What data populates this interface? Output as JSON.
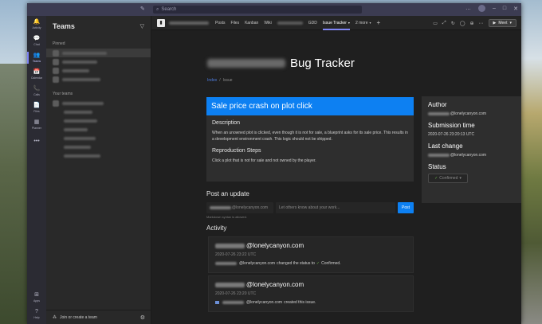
{
  "titlebar": {
    "search_placeholder": "Search",
    "nav_icon": "compose-icon",
    "controls": [
      "…",
      "–",
      "□",
      "✕"
    ]
  },
  "rail": {
    "items": [
      {
        "label": "Activity",
        "icon": "bell-icon",
        "glyph": "🔔"
      },
      {
        "label": "Chat",
        "icon": "chat-icon",
        "glyph": "💬"
      },
      {
        "label": "Teams",
        "icon": "teams-icon",
        "glyph": "👥",
        "active": true
      },
      {
        "label": "Calendar",
        "icon": "calendar-icon",
        "glyph": "📅"
      },
      {
        "label": "Calls",
        "icon": "phone-icon",
        "glyph": "📞"
      },
      {
        "label": "Files",
        "icon": "file-icon",
        "glyph": "📄"
      },
      {
        "label": "Planner",
        "icon": "planner-icon",
        "glyph": "▦"
      },
      {
        "label": "",
        "icon": "more-icon",
        "glyph": "•••"
      }
    ],
    "bottom": [
      {
        "label": "Apps",
        "icon": "apps-icon",
        "glyph": "⊞"
      },
      {
        "label": "Help",
        "icon": "help-icon",
        "glyph": "?"
      }
    ]
  },
  "panel": {
    "title": "Teams",
    "pinned_label": "Pinned",
    "your_teams_label": "Your teams",
    "join_label": "Join or create a team"
  },
  "channel": {
    "tabs": [
      "Posts",
      "Files",
      "Kanban",
      "Wiki",
      "GDD",
      "Issue Tracker",
      "2 more"
    ],
    "meet_label": "Meet"
  },
  "page": {
    "title_suffix": "Bug Tracker",
    "crumb_index": "Index",
    "crumb_sep": "/",
    "crumb_current": "Issue"
  },
  "issue": {
    "title": "Sale price crash on plot click",
    "desc_heading": "Description",
    "desc_text": "When an unowned plot is clicked, even though it is not for sale, a blueprint asks for its sale price. This results in a development environment crash. This logic should not be shipped.",
    "repro_heading": "Reproduction Steps",
    "repro_text": "Click a plot that is not for sale and not owned by the player."
  },
  "meta": {
    "author_label": "Author",
    "author_email": "@lonelycanyon.com",
    "submitted_label": "Submission time",
    "submitted_value": "2020-07-26 23:20:13 UTC",
    "last_change_label": "Last change",
    "last_change_email": "@lonelycanyon.com",
    "status_label": "Status",
    "status_value": "Confirmed"
  },
  "post": {
    "heading": "Post an update",
    "email": "@lonelycanyon.com",
    "placeholder": "Let others know about your work...",
    "button": "Post",
    "note": "Markdown syntax is allowed."
  },
  "activity": {
    "heading": "Activity",
    "entries": [
      {
        "email": "@lonelycanyon.com",
        "time": "2020-07-26 23:22 UTC",
        "text_email": "@lonelycanyon.com",
        "text": "changed the status to",
        "status": "Confirmed."
      },
      {
        "email": "@lonelycanyon.com",
        "time": "2020-07-26 23:20 UTC",
        "text_email": "@lonelycanyon.com",
        "text": "created this issue."
      }
    ]
  }
}
